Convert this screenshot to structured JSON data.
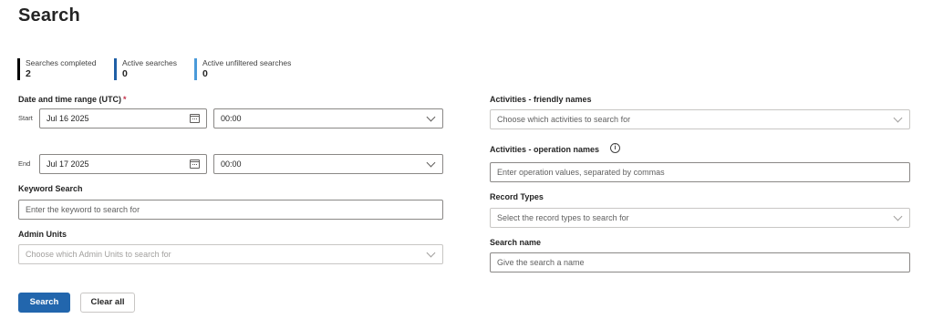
{
  "page": {
    "title": "Search"
  },
  "stats": [
    {
      "label": "Searches completed",
      "value": "2",
      "color": "#000000"
    },
    {
      "label": "Active searches",
      "value": "0",
      "color": "#1f5fa6"
    },
    {
      "label": "Active unfiltered searches",
      "value": "0",
      "color": "#4a9ad9"
    }
  ],
  "date_range": {
    "label": "Date and time range (UTC)",
    "required_mark": "*",
    "start": {
      "label": "Start",
      "date": "Jul 16 2025",
      "time": "00:00"
    },
    "end": {
      "label": "End",
      "date": "Jul 17 2025",
      "time": "00:00"
    }
  },
  "keyword": {
    "label": "Keyword Search",
    "placeholder": "Enter the keyword to search for"
  },
  "admin_units": {
    "label": "Admin Units",
    "placeholder": "Choose which Admin Units to search for"
  },
  "activities_friendly": {
    "label": "Activities - friendly names",
    "placeholder": "Choose which activities to search for"
  },
  "activities_operation": {
    "label": "Activities - operation names",
    "info_glyph": "i",
    "placeholder": "Enter operation values, separated by commas"
  },
  "record_types": {
    "label": "Record Types",
    "placeholder": "Select the record types to search for"
  },
  "search_name": {
    "label": "Search name",
    "placeholder": "Give the search a name"
  },
  "actions": {
    "search_label": "Search",
    "clear_label": "Clear all"
  },
  "colors": {
    "primary": "#2266ad",
    "required": "#c4314b"
  }
}
